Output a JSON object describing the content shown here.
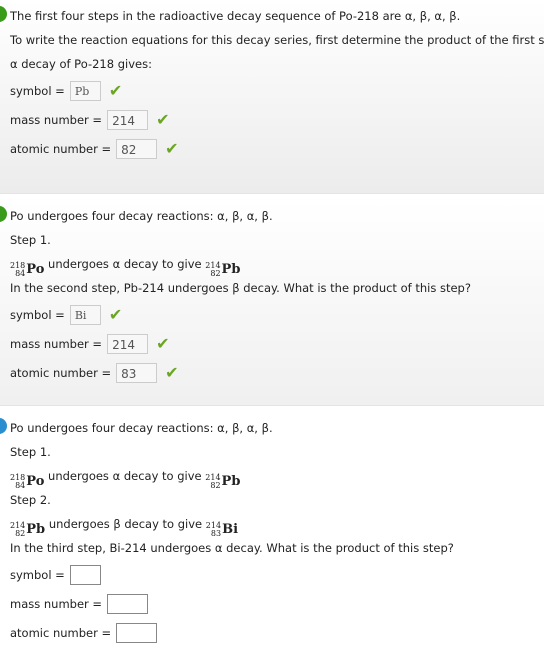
{
  "colors": {
    "done_marker": "#3a9a1a",
    "current_marker": "#2a8fd0",
    "check": "#6aa524"
  },
  "part1": {
    "intro": "The first four steps in the radioactive decay sequence of Po-218 are α, β, α, β.",
    "instruction": "To write the reaction equations for this decay series, first determine the product of the first step.",
    "prompt": "α decay of Po-218 gives:",
    "fields": [
      {
        "label": "symbol =",
        "value": "Pb",
        "correct": true
      },
      {
        "label": "mass number =",
        "value": "214",
        "correct": true
      },
      {
        "label": "atomic number =",
        "value": "82",
        "correct": true
      }
    ]
  },
  "part2": {
    "intro": "Po undergoes four decay reactions: α, β, α, β.",
    "step1": "Step 1.",
    "eq1": {
      "from": {
        "mass": "218",
        "z": "84",
        "el": "Po"
      },
      "text": "undergoes α decay to give",
      "to": {
        "mass": "214",
        "z": "82",
        "el": "Pb"
      }
    },
    "question": "In the second step, Pb-214 undergoes β decay. What is the product of this step?",
    "fields": [
      {
        "label": "symbol =",
        "value": "Bi",
        "correct": true
      },
      {
        "label": "mass number =",
        "value": "214",
        "correct": true
      },
      {
        "label": "atomic number =",
        "value": "83",
        "correct": true
      }
    ]
  },
  "part3": {
    "intro": "Po undergoes four decay reactions: α, β, α, β.",
    "step1": "Step 1.",
    "eq1": {
      "from": {
        "mass": "218",
        "z": "84",
        "el": "Po"
      },
      "text": "undergoes α decay to give",
      "to": {
        "mass": "214",
        "z": "82",
        "el": "Pb"
      }
    },
    "step2": "Step 2.",
    "eq2": {
      "from": {
        "mass": "214",
        "z": "82",
        "el": "Pb"
      },
      "text": "undergoes β decay to give",
      "to": {
        "mass": "214",
        "z": "83",
        "el": "Bi"
      }
    },
    "question": "In the third step, Bi-214 undergoes α decay. What is the product of this step?",
    "fields": [
      {
        "label": "symbol =",
        "value": ""
      },
      {
        "label": "mass number =",
        "value": ""
      },
      {
        "label": "atomic number =",
        "value": ""
      }
    ]
  }
}
